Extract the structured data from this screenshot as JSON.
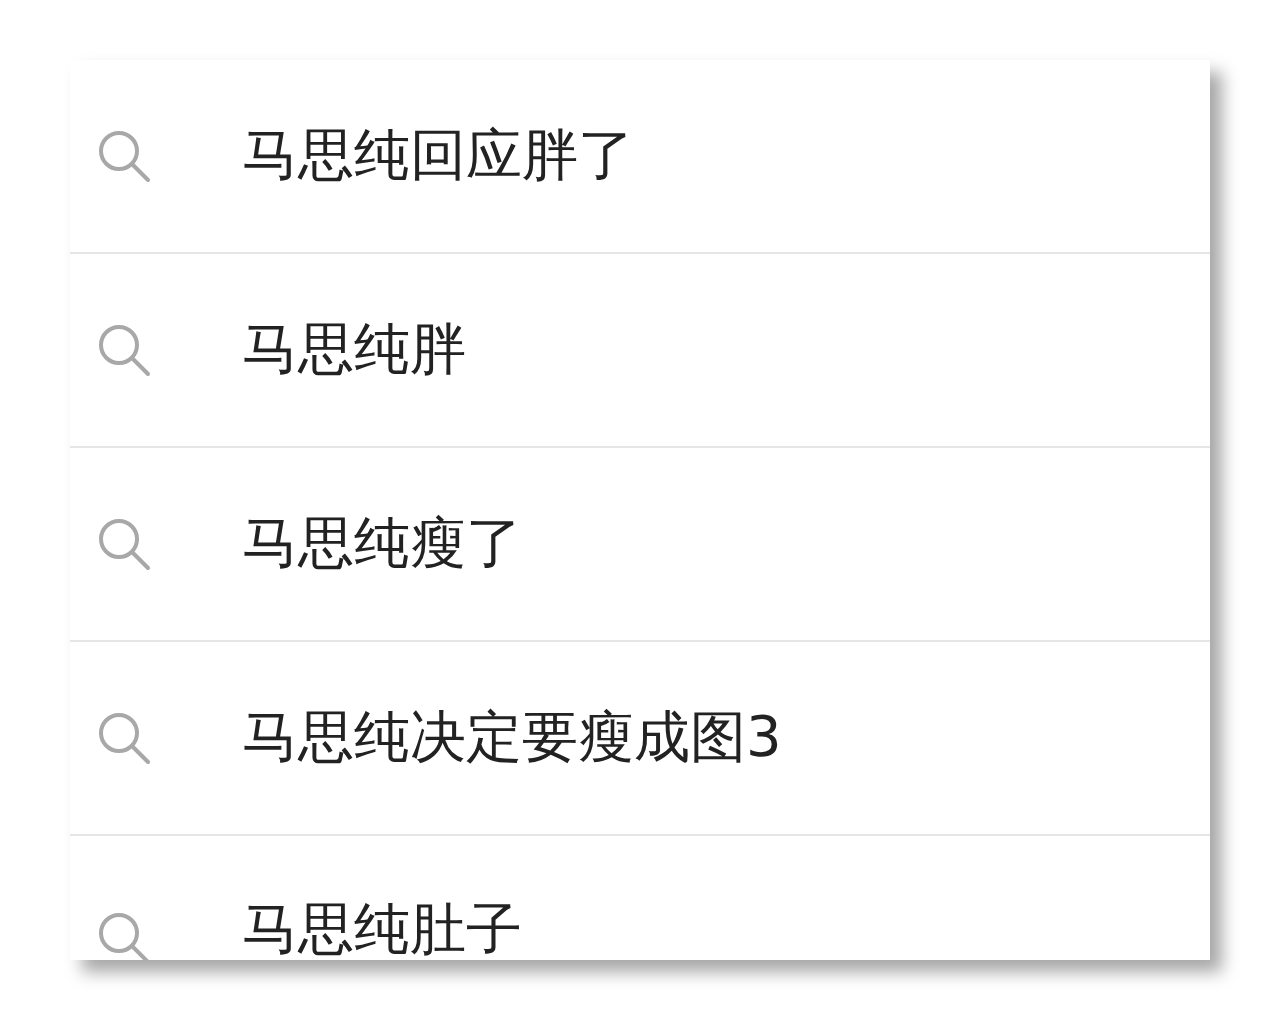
{
  "suggestions": [
    {
      "text": "马思纯回应胖了"
    },
    {
      "text": "马思纯胖"
    },
    {
      "text": "马思纯瘦了"
    },
    {
      "text": "马思纯决定要瘦成图3"
    },
    {
      "text": "马思纯肚子"
    }
  ]
}
